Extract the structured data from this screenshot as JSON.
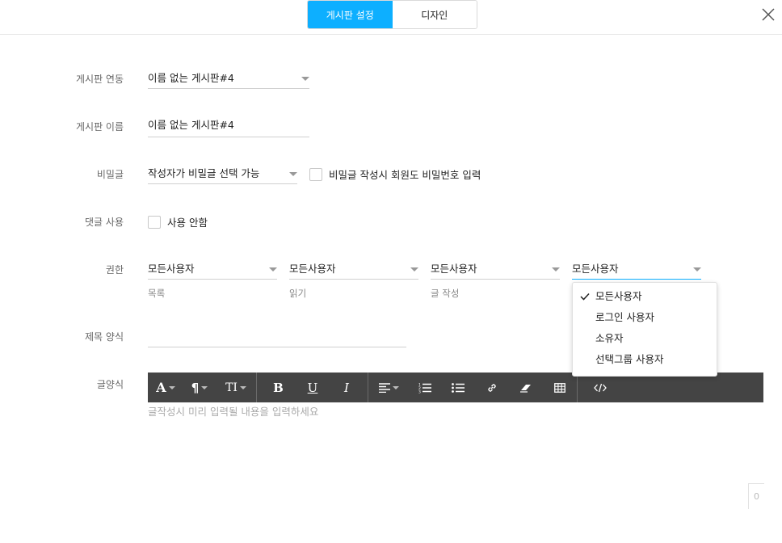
{
  "header": {
    "tabs": [
      {
        "label": "게시판 설정",
        "active": true
      },
      {
        "label": "디자인",
        "active": false
      }
    ],
    "close_icon": "close-icon",
    "accent_color": "#0dafff"
  },
  "form": {
    "link": {
      "label": "게시판 연동",
      "value": "이름 없는 게시판#4"
    },
    "name": {
      "label": "게시판 이름",
      "value": "이름 없는 게시판#4"
    },
    "secret": {
      "label": "비밀글",
      "value": "작성자가 비밀글 선택 가능",
      "checkbox_label": "비밀글 작성시 회원도 비밀번호 입력",
      "checked": false
    },
    "comment": {
      "label": "댓글 사용",
      "checkbox_label": "사용 안함",
      "checked": false
    },
    "permission": {
      "label": "권한",
      "selects": [
        {
          "value": "모든사용자",
          "sublabel": "목록"
        },
        {
          "value": "모든사용자",
          "sublabel": "읽기"
        },
        {
          "value": "모든사용자",
          "sublabel": "글 작성"
        },
        {
          "value": "모든사용자",
          "sublabel": ""
        }
      ],
      "dropdown_options": [
        {
          "label": "모든사용자",
          "selected": true
        },
        {
          "label": "로그인 사용자",
          "selected": false
        },
        {
          "label": "소유자",
          "selected": false
        },
        {
          "label": "선택그룹 사용자",
          "selected": false
        }
      ]
    },
    "title_format": {
      "label": "제목 양식",
      "value": ""
    },
    "body_format": {
      "label": "글양식",
      "placeholder": "글작성시 미리 입력될 내용을 입력하세요",
      "char_count": "0"
    }
  },
  "toolbar": {
    "font_icon": "A",
    "paragraph_icon": "¶",
    "size_icon": "TI",
    "bold_icon": "B",
    "underline_icon": "U",
    "italic_icon": "I"
  }
}
